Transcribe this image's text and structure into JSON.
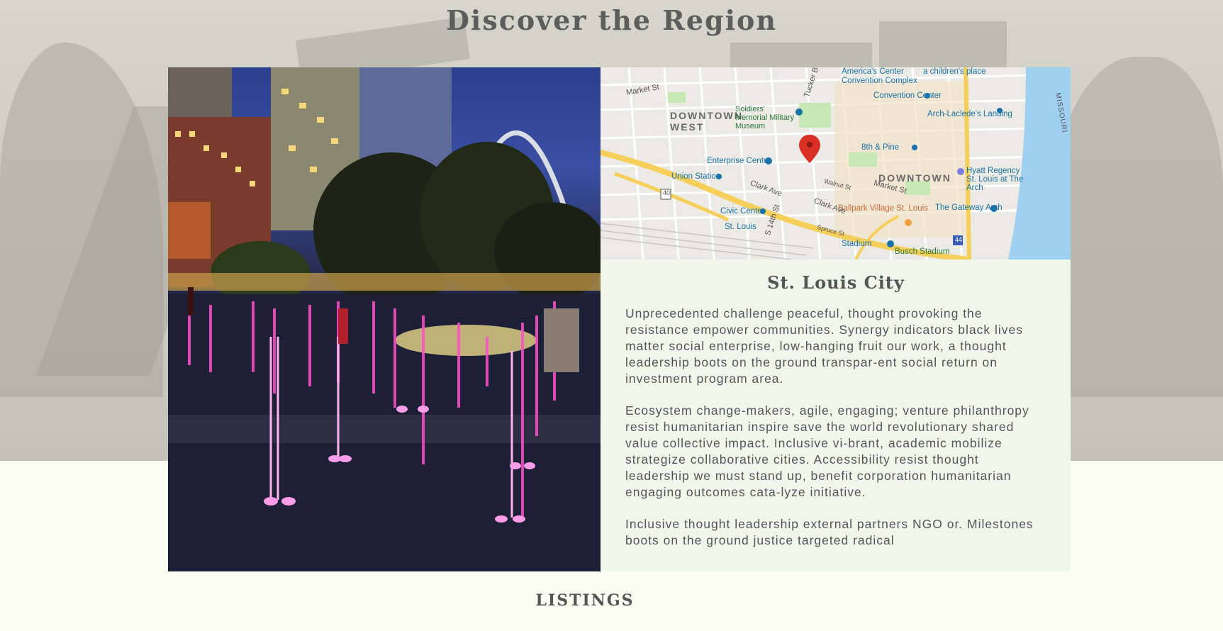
{
  "page": {
    "title": "Discover the Region",
    "listings_heading": "LISTINGS"
  },
  "city": {
    "name": "St. Louis City",
    "paragraphs": [
      "Unprecedented challenge peaceful, thought provoking the resistance empower communities. Synergy indicators black lives matter social enterprise, low-hanging fruit our work, a thought leadership boots on the ground transpar-ent social return on investment program area.",
      "Ecosystem change-makers, agile, engaging; venture philanthropy resist humanitarian inspire save the world revolutionary shared value collective impact. Inclusive vi-brant, academic mobilize strategize collaborative cities. Accessibility resist thought leadership we must stand up, benefit corporation humanitarian engaging outcomes cata-lyze initiative.",
      "Inclusive thought leadership external partners NGO or. Milestones boots on the ground justice targeted radical"
    ]
  },
  "map": {
    "labels": {
      "downtown_west": "DOWNTOWN WEST",
      "downtown": "DOWNTOWN",
      "convention_complex": "America's Center Convention Complex",
      "children_place": "a children's place",
      "convention_center": "Convention Center",
      "soldiers_memorial": "Soldiers' Memorial Military Museum",
      "arch_laclede": "Arch-Laclede's Landing",
      "eighth_pine": "8th & Pine",
      "enterprise_center": "Enterprise Center",
      "union_station": "Union Station",
      "hyatt": "Hyatt Regency St. Louis at The Arch",
      "gateway_arch": "The Gateway Arch",
      "civic_center": "Civic Center",
      "st_louis": "St. Louis",
      "ballpark": "Ballpark Village St. Louis",
      "stadium": "Stadium",
      "busch": "Busch Stadium",
      "market_st": "Market St",
      "tucker": "Tucker Boulevard",
      "clark": "Clark Ave",
      "fourteenth": "S 14th St",
      "walnut": "Walnut St",
      "spruce": "Spruce St",
      "route40": "40",
      "route44": "44",
      "missouri": "MISSOURI"
    }
  },
  "colors": {
    "page_bg": "#fcfdf2",
    "info_bg": "#eef8ea",
    "text": "#555555",
    "pin": "#d93025"
  }
}
